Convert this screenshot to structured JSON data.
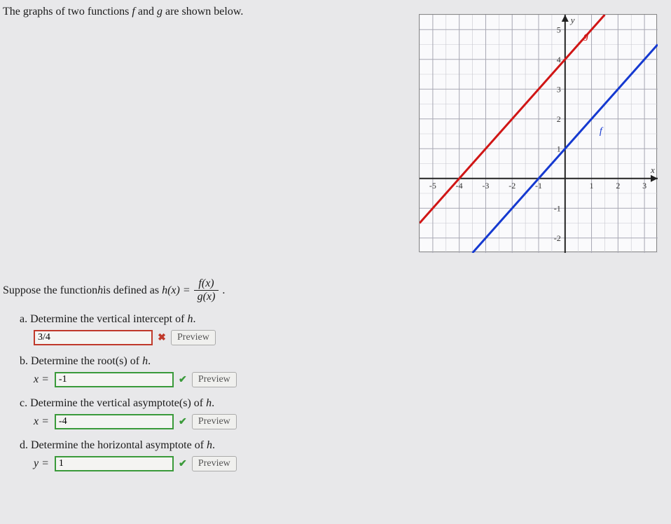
{
  "intro": {
    "prefix": "The graphs of two functions ",
    "f": "f",
    "mid": " and ",
    "g": "g",
    "suffix": " are shown below."
  },
  "definition": {
    "prefix": "Suppose the function ",
    "h": "h",
    "mid1": " is defined as ",
    "lhs": "h(x) = ",
    "num": "f(x)",
    "den": "g(x)",
    "period": "."
  },
  "questions": {
    "a": {
      "label": "a. Determine the vertical intercept of ",
      "fn": "h",
      "end": "."
    },
    "b": {
      "label": "b. Determine the root(s) of ",
      "fn": "h",
      "end": "."
    },
    "c": {
      "label": "c. Determine the vertical asymptote(s) of ",
      "fn": "h",
      "end": "."
    },
    "d": {
      "label": "d. Determine the horizontal asymptote of ",
      "fn": "h",
      "end": "."
    }
  },
  "answers": {
    "a": {
      "value": "3/4",
      "status": "wrong"
    },
    "b": {
      "prefix": "x =",
      "value": "-1",
      "status": "right"
    },
    "c": {
      "prefix": "x =",
      "value": "-4",
      "status": "right"
    },
    "d": {
      "prefix": "y =",
      "value": "1",
      "status": "right"
    }
  },
  "marks": {
    "wrong": "✖",
    "right": "✔"
  },
  "preview_label": "Preview",
  "chart_data": {
    "type": "line",
    "title": "",
    "xlabel": "x",
    "ylabel": "",
    "xlim": [
      -5.5,
      3.5
    ],
    "ylim": [
      -2.5,
      5.5
    ],
    "xticks": [
      -5,
      -4,
      -3,
      -2,
      -1,
      1,
      2,
      3
    ],
    "yticks": [
      -2,
      -1,
      1,
      2,
      3,
      4,
      5
    ],
    "grid": true,
    "series": [
      {
        "name": "g",
        "color": "#d01515",
        "points": [
          [
            -5,
            -1
          ],
          [
            -4,
            0
          ],
          [
            -3,
            1
          ],
          [
            -2,
            2
          ],
          [
            -1,
            3
          ],
          [
            0,
            4
          ],
          [
            1,
            5
          ]
        ],
        "label_pos": [
          0.7,
          4.7
        ]
      },
      {
        "name": "f",
        "color": "#1539d0",
        "points": [
          [
            -3,
            -2
          ],
          [
            -2,
            -1
          ],
          [
            -1,
            0
          ],
          [
            0,
            1
          ],
          [
            1,
            2
          ],
          [
            2,
            3
          ],
          [
            3,
            4
          ]
        ],
        "label_pos": [
          1.3,
          1.5
        ]
      }
    ],
    "axis_arrow_labels": {
      "x": "x",
      "y": "y"
    }
  }
}
